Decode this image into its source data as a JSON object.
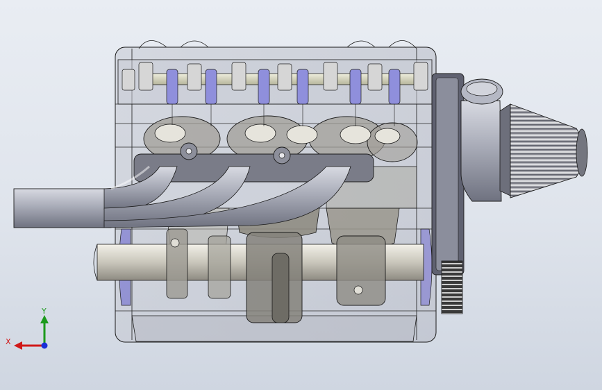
{
  "colors": {
    "background_top": "#e9edf3",
    "background_bottom": "#cfd6e1",
    "wire": "#1a1a1a",
    "metal_light": "#d4d6dc",
    "metal_dark": "#8a8c95",
    "pipe": "#a7aab6",
    "valve_blue": "#8f8fdc",
    "block_edge_blue": "#6a66c4",
    "cam_bar": "#dcdcc6",
    "x_axis": "#d01818",
    "y_axis": "#1c9a1c",
    "z_axis": "#1a2fd8"
  },
  "triad": {
    "x_label": "X",
    "y_label": "Y"
  },
  "model": {
    "cylinder_count": 4,
    "valve_count": 6,
    "rocker_count": 8
  }
}
